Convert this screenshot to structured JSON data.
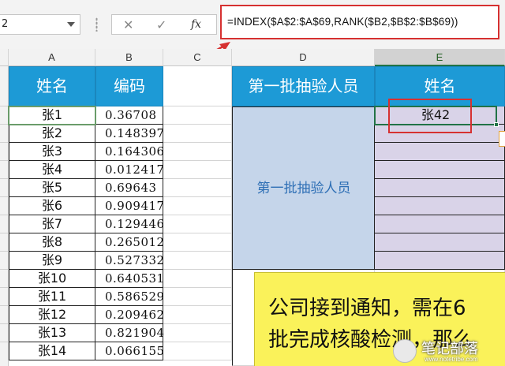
{
  "formula_bar": {
    "name_box": "2",
    "cancel_glyph": "✕",
    "confirm_glyph": "✓",
    "fx_label": "fx",
    "formula": "=INDEX($A$2:$A$69,RANK($B2,$B$2:$B$69))"
  },
  "columns": [
    "A",
    "B",
    "C",
    "D",
    "E"
  ],
  "headers": {
    "a": "姓名",
    "b": "编码",
    "d": "第一批抽验人员",
    "e": "姓名"
  },
  "rows": [
    {
      "name": "张1",
      "code": "0.36708"
    },
    {
      "name": "张2",
      "code": "0.148397"
    },
    {
      "name": "张3",
      "code": "0.164306"
    },
    {
      "name": "张4",
      "code": "0.012417"
    },
    {
      "name": "张5",
      "code": "0.69643"
    },
    {
      "name": "张6",
      "code": "0.909417"
    },
    {
      "name": "张7",
      "code": "0.129446"
    },
    {
      "name": "张8",
      "code": "0.265012"
    },
    {
      "name": "张9",
      "code": "0.527332"
    },
    {
      "name": "张10",
      "code": "0.640531"
    },
    {
      "name": "张11",
      "code": "0.586529"
    },
    {
      "name": "张12",
      "code": "0.209462"
    },
    {
      "name": "张13",
      "code": "0.821904"
    },
    {
      "name": "张14",
      "code": "0.066155"
    }
  ],
  "merged_d_label": "第一批抽验人员",
  "e_result": "张42",
  "callout": {
    "line1": "公司接到通知，需在6",
    "line2": "批完成核酸检测，那么"
  },
  "watermark": {
    "text": "笔记部落",
    "url": "www.notetribe.com"
  },
  "colors": {
    "header_blue": "#1d9ad6",
    "merged_blue": "#c5d5ea",
    "lavender": "#d9d3e8",
    "highlight_red": "#d63131",
    "callout_yellow": "#faf25a",
    "excel_green": "#217346"
  }
}
